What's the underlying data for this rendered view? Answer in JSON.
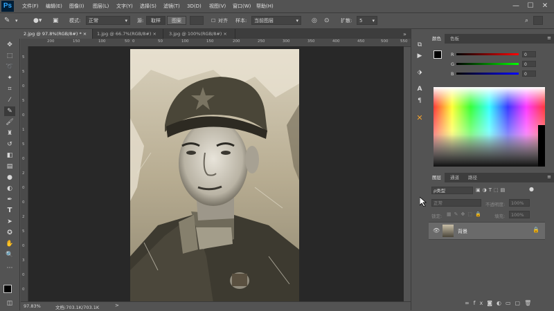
{
  "app": {
    "logo": "Ps"
  },
  "menu": [
    "文件(F)",
    "编辑(E)",
    "图像(I)",
    "图层(L)",
    "文字(Y)",
    "选择(S)",
    "滤镜(T)",
    "3D(D)",
    "视图(V)",
    "窗口(W)",
    "帮助(H)"
  ],
  "window_controls": {
    "minimize": "—",
    "maximize": "☐",
    "close": "✕"
  },
  "options": {
    "mode_label": "模式:",
    "mode_value": "正常",
    "source_label": "源:",
    "sample_btn": "取样",
    "pattern_btn": "图案",
    "align_label": "对齐",
    "sample_label": "样本:",
    "sample_value": "当前图层",
    "diffusion_label": "扩散:",
    "diffusion_value": "5"
  },
  "tabs": [
    {
      "label": "2.jpg @ 97.8%(RGB/8#) *",
      "close": "×",
      "active": true
    },
    {
      "label": "1.jpg @ 66.7%(RGB/8#)",
      "close": "×",
      "active": false
    },
    {
      "label": "3.jpg @ 100%(RGB/8#)",
      "close": "×",
      "active": false
    }
  ],
  "ruler_top": [
    "200",
    "150",
    "100",
    "50",
    "0",
    "50",
    "100",
    "150",
    "200",
    "250",
    "300",
    "350",
    "400",
    "450",
    "500",
    "550"
  ],
  "ruler_left": [
    "5",
    "5",
    "0",
    "5",
    "0",
    "1",
    "5",
    "0",
    "2",
    "0",
    "0",
    "2",
    "5",
    "0",
    "3",
    "0",
    "0"
  ],
  "status": {
    "zoom": "97.83%",
    "doc": "文档:703.1K/703.1K",
    "arrow": ">"
  },
  "color_panel": {
    "tabs": [
      "颜色",
      "色板"
    ],
    "channels": [
      {
        "label": "R",
        "value": "0",
        "color": "#e03030"
      },
      {
        "label": "G",
        "value": "0",
        "color": "#30c030"
      },
      {
        "label": "B",
        "value": "0",
        "color": "#3050e0"
      }
    ]
  },
  "layers_panel": {
    "tabs": [
      "图层",
      "通道",
      "路径"
    ],
    "kind_label": "ρ类型",
    "blend_mode": "正常",
    "opacity_label": "不透明度:",
    "opacity_value": "100%",
    "lock_label": "锁定:",
    "fill_label": "填充:",
    "fill_value": "100%",
    "layer_name": "背景"
  },
  "colors": {
    "accent": "#31a8ff",
    "panel": "#535353",
    "dark": "#282828"
  }
}
